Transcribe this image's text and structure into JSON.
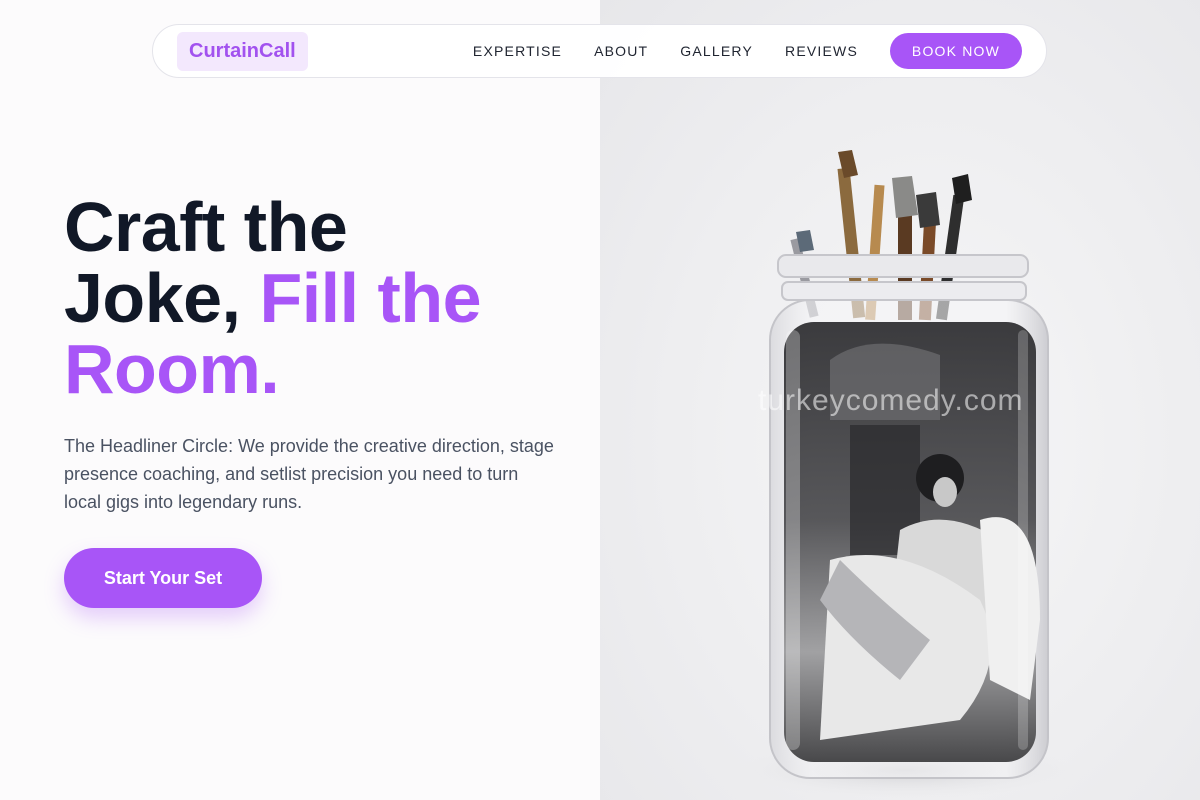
{
  "brand": {
    "name": "CurtainCall"
  },
  "nav": {
    "links": [
      "EXPERTISE",
      "ABOUT",
      "GALLERY",
      "REVIEWS"
    ],
    "cta": "BOOK NOW"
  },
  "hero": {
    "title_line1": "Craft the",
    "title_line2": "Joke,",
    "title_accent_1": "Fill the",
    "title_accent_2": "Room.",
    "description": "The Headliner Circle: We provide the creative direction, stage presence coaching, and setlist precision you need to turn local gigs into legendary runs.",
    "cta": "Start Your Set"
  },
  "image": {
    "watermark": "turkeycomedy.com"
  },
  "colors": {
    "accent": "#a855f7",
    "heading": "#111827",
    "logo_bg": "#f3e8fd"
  }
}
